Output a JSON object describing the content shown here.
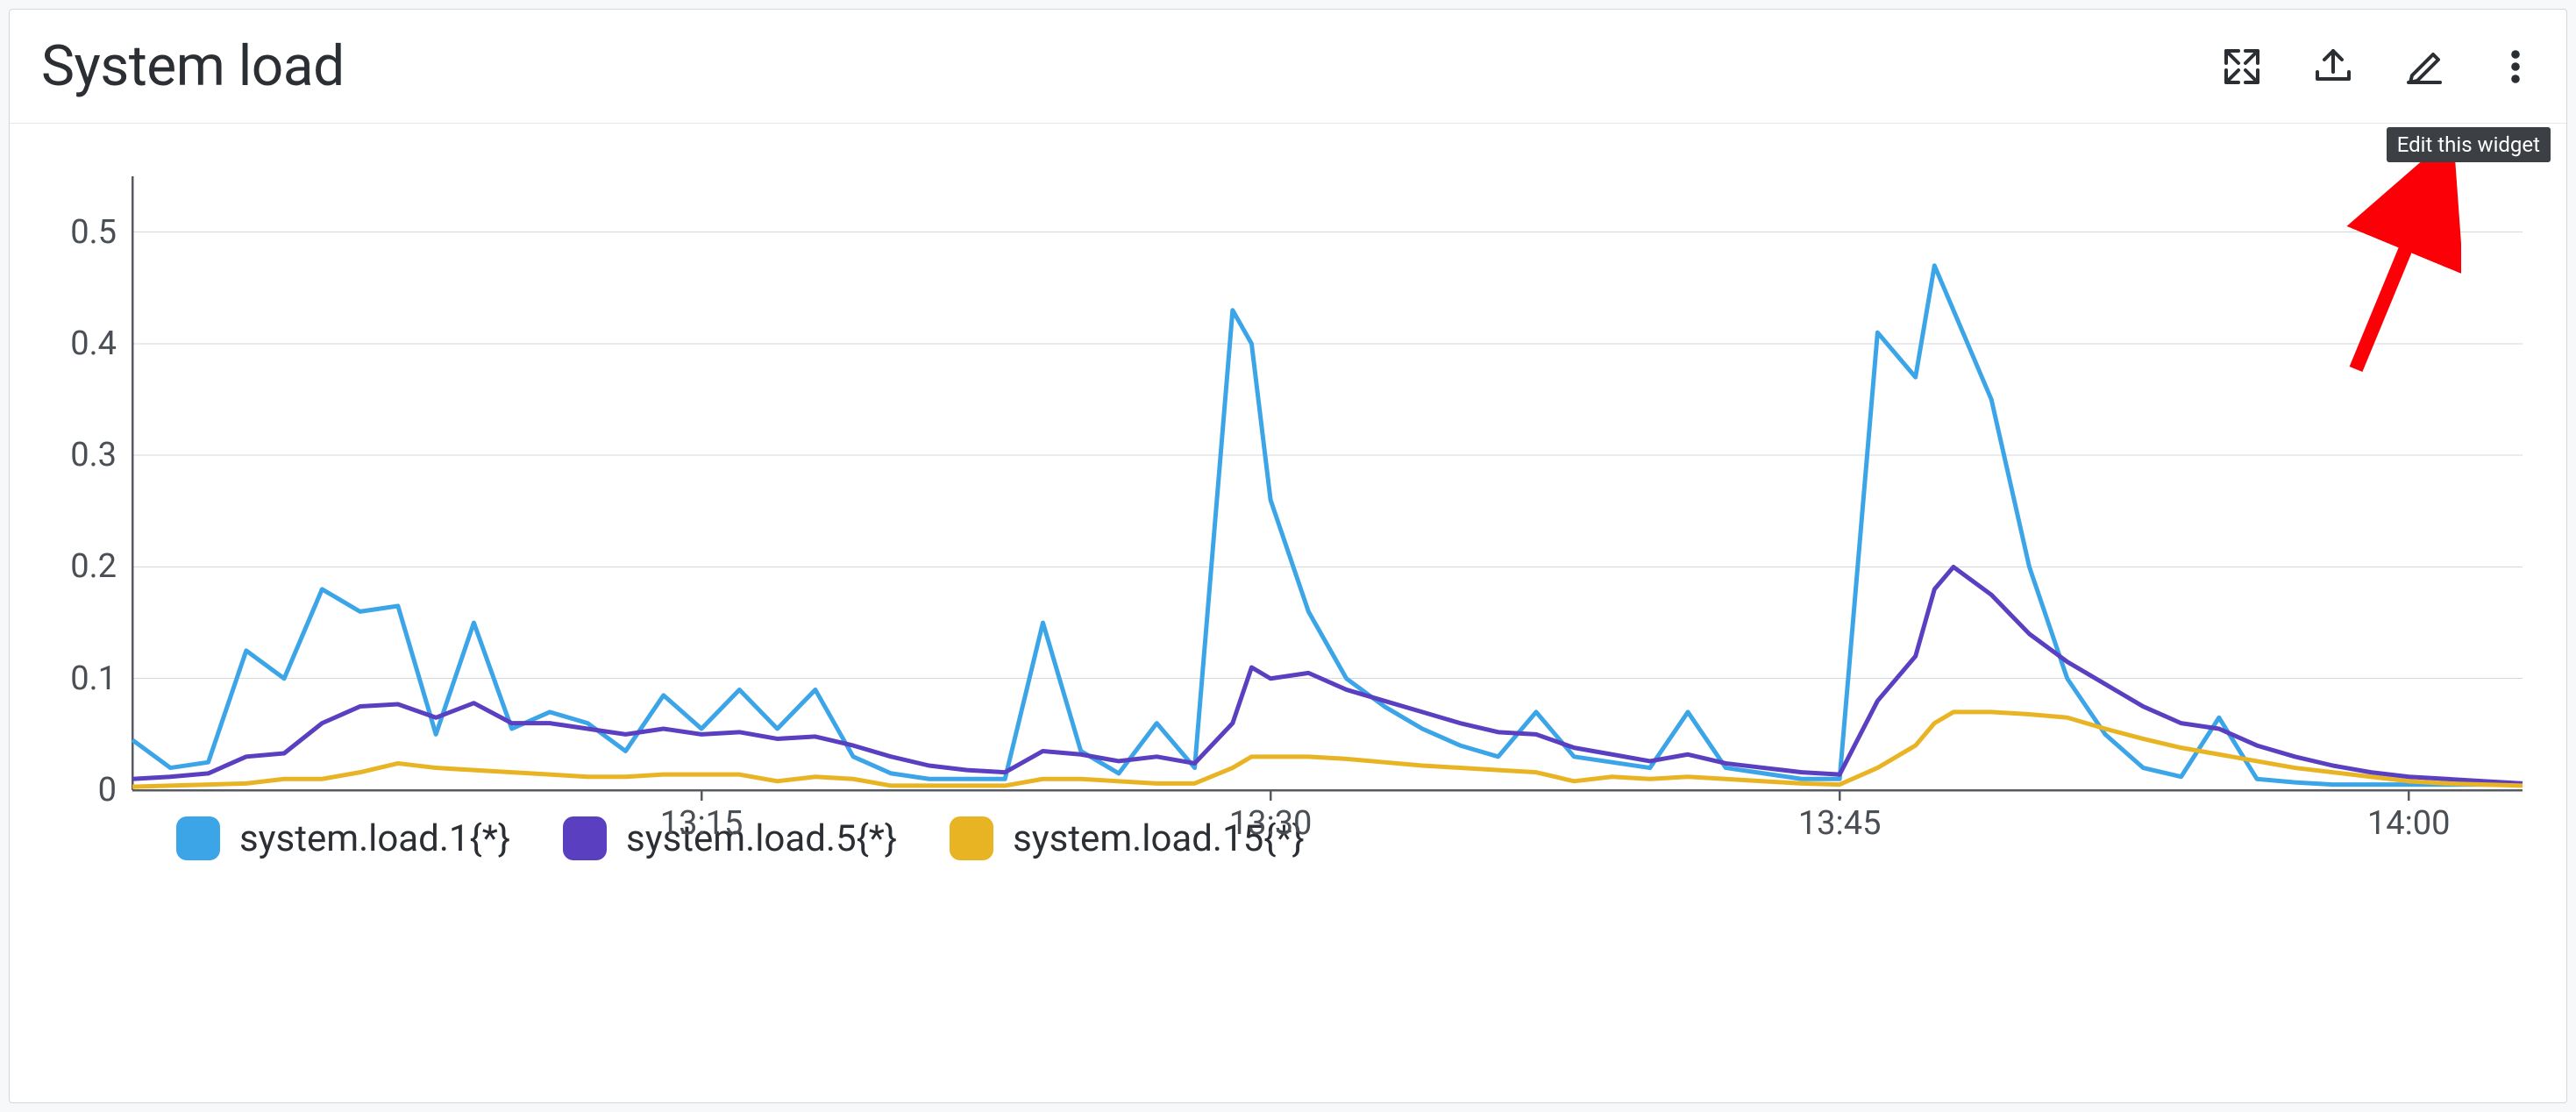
{
  "title": "System load",
  "tooltip": "Edit this widget",
  "colors": {
    "s1": "#3ca5e8",
    "s5": "#5a3fc0",
    "s15": "#e8b424",
    "arrow": "#fb0007"
  },
  "chart_data": {
    "type": "line",
    "title": "System load",
    "xlabel": "",
    "ylabel": "",
    "ylim": [
      0,
      0.55
    ],
    "y_ticks": [
      0,
      0.1,
      0.2,
      0.3,
      0.4,
      0.5
    ],
    "x_ticks": [
      {
        "minute": 15,
        "label": "13:15"
      },
      {
        "minute": 30,
        "label": "13:30"
      },
      {
        "minute": 45,
        "label": "13:45"
      },
      {
        "minute": 60,
        "label": "14:00"
      }
    ],
    "x_range_minutes": [
      0,
      63
    ],
    "x": [
      0,
      1,
      2,
      3,
      4,
      5,
      6,
      7,
      8,
      9,
      10,
      11,
      12,
      13,
      14,
      15,
      16,
      17,
      18,
      19,
      20,
      21,
      22,
      23,
      24,
      25,
      26,
      27,
      28,
      29,
      29.5,
      30,
      31,
      32,
      33,
      34,
      35,
      36,
      37,
      38,
      39,
      40,
      41,
      42,
      43,
      44,
      45,
      46,
      47,
      47.5,
      48,
      49,
      50,
      51,
      52,
      53,
      54,
      55,
      56,
      57,
      58,
      59,
      60,
      61,
      62,
      63
    ],
    "series": [
      {
        "name": "system.load.1{*}",
        "color_key": "s1",
        "values": [
          0.045,
          0.02,
          0.025,
          0.125,
          0.1,
          0.18,
          0.16,
          0.165,
          0.05,
          0.15,
          0.055,
          0.07,
          0.06,
          0.035,
          0.085,
          0.055,
          0.09,
          0.055,
          0.09,
          0.03,
          0.015,
          0.01,
          0.01,
          0.01,
          0.15,
          0.035,
          0.015,
          0.06,
          0.02,
          0.43,
          0.4,
          0.26,
          0.16,
          0.1,
          0.075,
          0.055,
          0.04,
          0.03,
          0.07,
          0.03,
          0.025,
          0.02,
          0.07,
          0.02,
          0.015,
          0.01,
          0.01,
          0.41,
          0.37,
          0.47,
          0.43,
          0.35,
          0.2,
          0.1,
          0.05,
          0.02,
          0.012,
          0.065,
          0.01,
          0.007,
          0.005,
          0.005,
          0.005,
          0.005,
          0.005,
          0.005
        ]
      },
      {
        "name": "system.load.5{*}",
        "color_key": "s5",
        "values": [
          0.01,
          0.012,
          0.015,
          0.03,
          0.033,
          0.06,
          0.075,
          0.077,
          0.065,
          0.078,
          0.06,
          0.06,
          0.055,
          0.05,
          0.055,
          0.05,
          0.052,
          0.046,
          0.048,
          0.04,
          0.03,
          0.022,
          0.018,
          0.016,
          0.035,
          0.032,
          0.026,
          0.03,
          0.024,
          0.06,
          0.11,
          0.1,
          0.105,
          0.09,
          0.08,
          0.07,
          0.06,
          0.052,
          0.05,
          0.038,
          0.032,
          0.026,
          0.032,
          0.024,
          0.02,
          0.016,
          0.014,
          0.08,
          0.12,
          0.18,
          0.2,
          0.175,
          0.14,
          0.115,
          0.095,
          0.075,
          0.06,
          0.055,
          0.04,
          0.03,
          0.022,
          0.016,
          0.012,
          0.01,
          0.008,
          0.006
        ]
      },
      {
        "name": "system.load.15{*}",
        "color_key": "s15",
        "values": [
          0.003,
          0.004,
          0.005,
          0.006,
          0.01,
          0.01,
          0.016,
          0.024,
          0.02,
          0.018,
          0.016,
          0.014,
          0.012,
          0.012,
          0.014,
          0.014,
          0.014,
          0.008,
          0.012,
          0.01,
          0.004,
          0.004,
          0.004,
          0.004,
          0.01,
          0.01,
          0.008,
          0.006,
          0.006,
          0.02,
          0.03,
          0.03,
          0.03,
          0.028,
          0.025,
          0.022,
          0.02,
          0.018,
          0.016,
          0.008,
          0.012,
          0.01,
          0.012,
          0.01,
          0.008,
          0.006,
          0.005,
          0.02,
          0.04,
          0.06,
          0.07,
          0.07,
          0.068,
          0.065,
          0.055,
          0.046,
          0.038,
          0.032,
          0.026,
          0.02,
          0.016,
          0.012,
          0.008,
          0.006,
          0.005,
          0.004
        ]
      }
    ]
  }
}
